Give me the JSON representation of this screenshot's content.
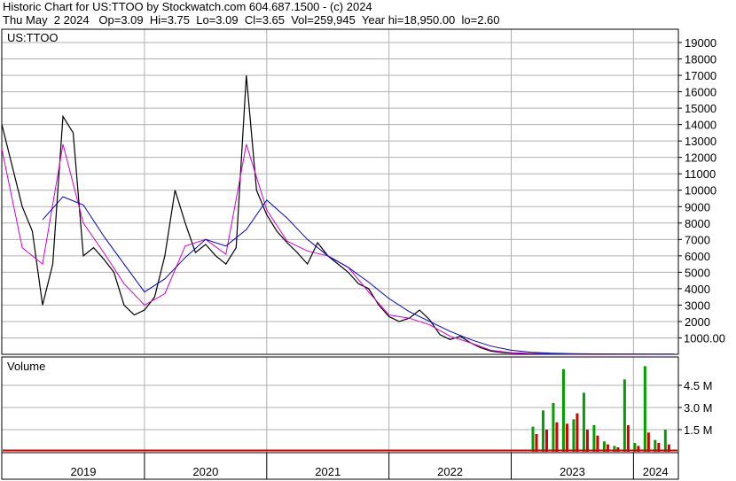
{
  "header": {
    "line1": "Historic Chart for US:TTOO by Stockwatch.com 604.687.1500 - (c) 2024",
    "line2": "Thu May  2 2024   Op=3.09  Hi=3.75  Lo=3.09  Cl=3.65  Vol=259,945  Year hi=18,950.00  lo=2.60"
  },
  "colors": {
    "price": "#000000",
    "ma_short": "#d400d4",
    "ma_long": "#0000cc",
    "vol_up": "#00a000",
    "vol_down": "#d40000",
    "grid": "#b0b0b0",
    "axis": "#000000"
  },
  "chart_data": [
    {
      "type": "line",
      "title": "US:TTOO",
      "xlabel": "",
      "ylabel": "",
      "x_tick_labels": [
        "2019",
        "2020",
        "2021",
        "2022",
        "2023",
        "2024"
      ],
      "y_tick_labels": [
        "19000",
        "18000",
        "17000",
        "16000",
        "15000",
        "14000",
        "13000",
        "12000",
        "11000",
        "10000",
        "9000",
        "8000",
        "7000",
        "6000",
        "5000",
        "4000",
        "3000",
        "2000",
        "1000.00"
      ],
      "ylim": [
        0,
        19000
      ],
      "grid": true,
      "series": [
        {
          "role": "price",
          "x": [
            "2018-11",
            "2018-12",
            "2019-01",
            "2019-02",
            "2019-03",
            "2019-04",
            "2019-05",
            "2019-06",
            "2019-07",
            "2019-08",
            "2019-09",
            "2019-10",
            "2019-11",
            "2019-12",
            "2020-01",
            "2020-02",
            "2020-03",
            "2020-04",
            "2020-05",
            "2020-06",
            "2020-07",
            "2020-08",
            "2020-09",
            "2020-10",
            "2020-11",
            "2020-12",
            "2021-01",
            "2021-02",
            "2021-03",
            "2021-04",
            "2021-05",
            "2021-06",
            "2021-07",
            "2021-08",
            "2021-09",
            "2021-10",
            "2021-11",
            "2021-12",
            "2022-01",
            "2022-02",
            "2022-03",
            "2022-04",
            "2022-05",
            "2022-06",
            "2022-07",
            "2022-08",
            "2022-09",
            "2022-10",
            "2022-11",
            "2022-12",
            "2023-01",
            "2023-02",
            "2023-03",
            "2023-04",
            "2023-05",
            "2023-06",
            "2023-07",
            "2023-08",
            "2023-09",
            "2023-10",
            "2023-11",
            "2023-12",
            "2024-01",
            "2024-02",
            "2024-03",
            "2024-04",
            "2024-05"
          ],
          "values": [
            14000,
            11500,
            9000,
            7500,
            3000,
            5500,
            14500,
            13500,
            6000,
            6500,
            5800,
            5000,
            3000,
            2400,
            2700,
            3500,
            6000,
            10000,
            8000,
            6200,
            6700,
            6000,
            5500,
            6500,
            17000,
            10000,
            8500,
            7500,
            6800,
            6200,
            5500,
            6800,
            6000,
            5500,
            5000,
            4300,
            4000,
            3000,
            2300,
            2000,
            2200,
            2700,
            2100,
            1200,
            900,
            1100,
            700,
            400,
            200,
            120,
            80,
            60,
            45,
            30,
            22,
            18,
            14,
            12,
            10,
            8,
            7,
            6,
            5,
            5,
            4.5,
            4,
            3.65
          ]
        },
        {
          "role": "moving-average-short",
          "x": [
            "2018-11",
            "2019-01",
            "2019-03",
            "2019-05",
            "2019-07",
            "2019-09",
            "2019-11",
            "2020-01",
            "2020-03",
            "2020-05",
            "2020-07",
            "2020-09",
            "2020-11",
            "2021-01",
            "2021-03",
            "2021-05",
            "2021-07",
            "2021-09",
            "2021-11",
            "2022-01",
            "2022-03",
            "2022-05",
            "2022-07",
            "2022-09",
            "2022-11",
            "2023-01",
            "2023-03",
            "2023-05",
            "2023-07",
            "2023-09",
            "2023-11",
            "2024-01",
            "2024-03",
            "2024-05"
          ],
          "values": [
            12500,
            6500,
            5500,
            12800,
            8000,
            6200,
            4300,
            3000,
            3700,
            6600,
            7000,
            6100,
            12800,
            8800,
            6900,
            6300,
            6000,
            5300,
            3800,
            2400,
            2200,
            1800,
            1100,
            700,
            250,
            90,
            50,
            30,
            18,
            12,
            9,
            7,
            5,
            4
          ]
        },
        {
          "role": "moving-average-long",
          "x": [
            "2019-03",
            "2019-05",
            "2019-07",
            "2019-09",
            "2019-11",
            "2020-01",
            "2020-03",
            "2020-05",
            "2020-07",
            "2020-09",
            "2020-11",
            "2021-01",
            "2021-03",
            "2021-05",
            "2021-07",
            "2021-09",
            "2021-11",
            "2022-01",
            "2022-03",
            "2022-05",
            "2022-07",
            "2022-09",
            "2022-11",
            "2023-01",
            "2023-03",
            "2023-05",
            "2023-07",
            "2023-09",
            "2023-11",
            "2024-01",
            "2024-03",
            "2024-05"
          ],
          "values": [
            8200,
            9600,
            9100,
            7200,
            5500,
            3800,
            4600,
            5900,
            7000,
            6600,
            7600,
            9400,
            8300,
            7000,
            6000,
            5300,
            4400,
            3400,
            2600,
            2000,
            1400,
            900,
            500,
            250,
            120,
            70,
            40,
            25,
            15,
            10,
            7,
            5
          ]
        }
      ]
    },
    {
      "type": "bar",
      "title": "Volume",
      "xlabel": "",
      "ylabel": "",
      "y_tick_labels": [
        "4.5 M",
        "3.0 M",
        "1.5 M"
      ],
      "ylim": [
        0,
        6000000
      ],
      "grid": true,
      "x": [
        "2023-03",
        "2023-04",
        "2023-05",
        "2023-06",
        "2023-07",
        "2023-08",
        "2023-09",
        "2023-10",
        "2023-11",
        "2023-12",
        "2024-01",
        "2024-02",
        "2024-03",
        "2024-04"
      ],
      "series": [
        {
          "name": "up",
          "values": [
            1700,
            2800,
            3300,
            5600,
            2200,
            4000,
            1800,
            700,
            400,
            4900,
            600,
            5800,
            800,
            1500
          ]
        },
        {
          "name": "down",
          "values": [
            1200,
            1500,
            2000,
            1900,
            2600,
            1500,
            1100,
            500,
            300,
            1800,
            400,
            1300,
            600,
            500
          ]
        }
      ],
      "value_unit": "thousands"
    }
  ]
}
